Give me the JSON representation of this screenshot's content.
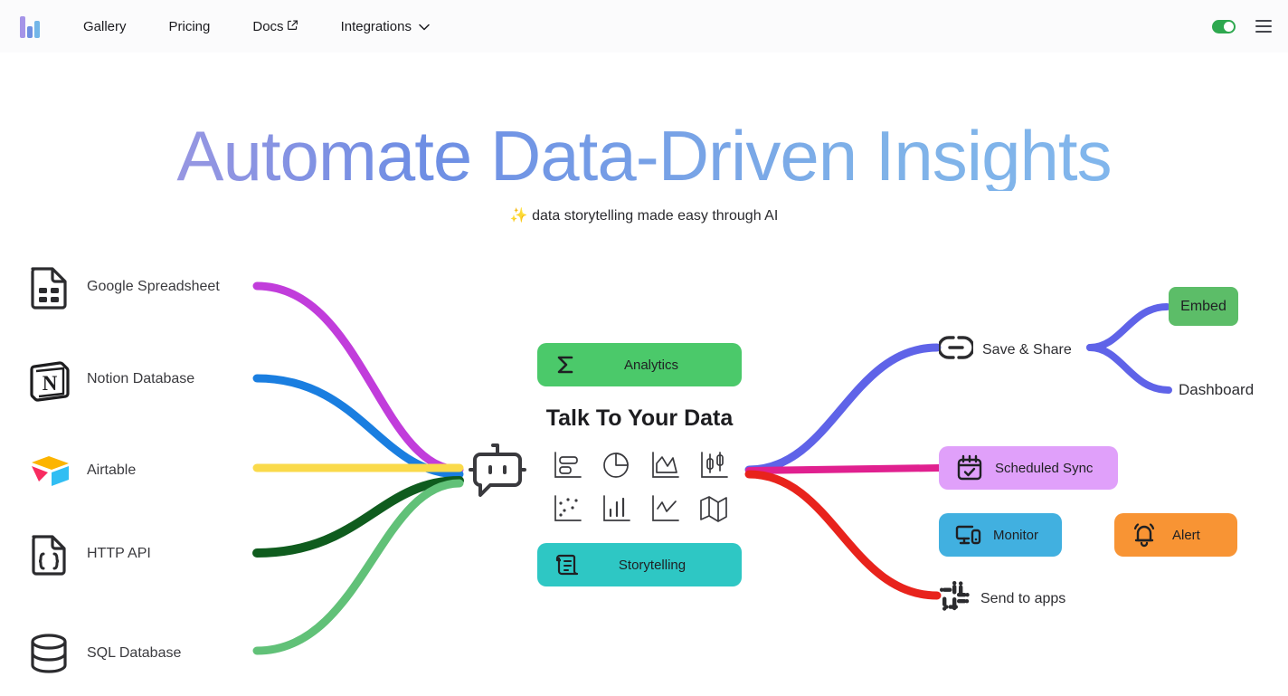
{
  "navbar": {
    "logo_name": "logo-bar-chart",
    "links": [
      {
        "label": "Gallery",
        "icon": ""
      },
      {
        "label": "Pricing",
        "icon": ""
      },
      {
        "label": "Docs",
        "icon": "external-link-icon"
      },
      {
        "label": "Integrations",
        "icon": "chevron-down-icon"
      }
    ],
    "toggle": {
      "name": "theme-toggle",
      "state": "on",
      "color": "#2ea84f"
    },
    "menu": {
      "name": "hamburger-menu-icon"
    }
  },
  "hero": {
    "title": "Automate Data-Driven Insights",
    "subtitle": "✨ data storytelling made easy through AI",
    "gradient_from": "#b49ce0",
    "gradient_to": "#83b9ef"
  },
  "sources": [
    {
      "label": "Google Spreadsheet",
      "icon": "spreadsheet-file-icon",
      "connector_color": "#c13ddb"
    },
    {
      "label": "Notion Database",
      "icon": "notion-icon",
      "connector_color": "#1a7ee0"
    },
    {
      "label": "Airtable",
      "icon": "airtable-icon",
      "connector_color": "#fada4b"
    },
    {
      "label": "HTTP API",
      "icon": "json-braces-file-icon",
      "connector_color": "#0f5c1e"
    },
    {
      "label": "SQL Database",
      "icon": "database-cylinder-icon",
      "connector_color": "#61c178"
    }
  ],
  "center": {
    "heading": "Talk To Your Data",
    "bot_icon": "chat-bot-icon",
    "analytics": {
      "label": "Analytics",
      "icon": "sigma-icon",
      "color": "#4bc96a"
    },
    "storytelling": {
      "label": "Storytelling",
      "icon": "scroll-document-icon",
      "color": "#2ec7c4"
    },
    "chart_icons": [
      "horizontal-bar-chart-icon",
      "pie-chart-icon",
      "area-chart-icon",
      "candlestick-chart-icon",
      "scatter-plot-icon",
      "vertical-bar-chart-icon",
      "line-chart-icon",
      "map-chart-icon"
    ]
  },
  "outputs": {
    "save_share": {
      "label": "Save & Share",
      "icon": "link-icon",
      "connector_color": "#5f63e8"
    },
    "embed": {
      "label": "Embed",
      "color": "#5cbd68"
    },
    "dashboard": {
      "label": "Dashboard"
    },
    "scheduled_sync": {
      "label": "Scheduled Sync",
      "icon": "calendar-check-icon",
      "color": "#e0a0fa",
      "connector_color": "#e0208f"
    },
    "monitor": {
      "label": "Monitor",
      "icon": "monitor-device-icon",
      "color": "#41b0e0"
    },
    "alert": {
      "label": "Alert",
      "icon": "bell-icon",
      "color": "#f89434"
    },
    "send_to_apps": {
      "label": "Send to apps",
      "icon": "slack-icon",
      "connector_color": "#e8231c"
    },
    "branch_color": "#5f63e8"
  }
}
